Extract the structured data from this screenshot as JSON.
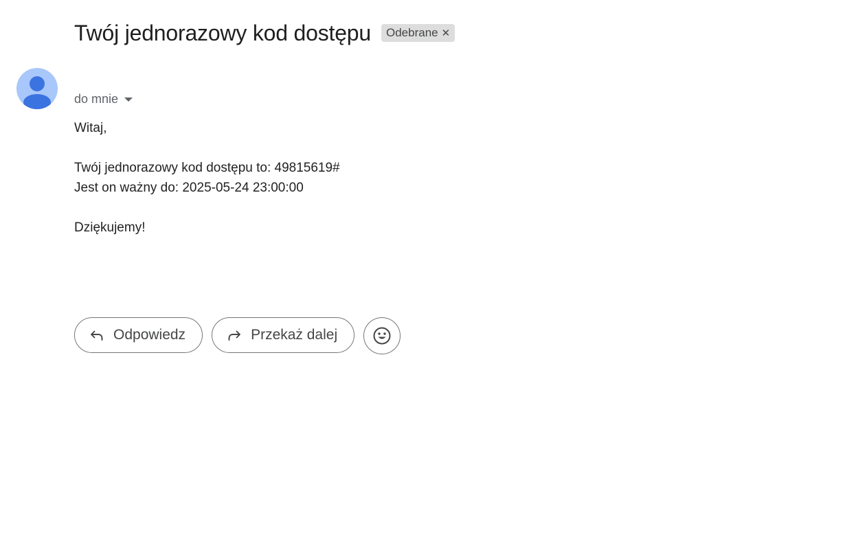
{
  "message": {
    "subject": "Twój jednorazowy kod dostępu",
    "label_chip": {
      "label": "Odebrane",
      "remove_icon": "close-icon"
    },
    "recipient": "do mnie",
    "avatar_icon": "person-avatar-icon",
    "body": {
      "greeting": "Witaj,",
      "code_line": "Twój jednorazowy kod dostępu to: 49815619#",
      "validity_line": "Jest on ważny do: 2025-05-24 23:00:00",
      "closing": "Dziękujemy!"
    }
  },
  "actions": {
    "reply_label": "Odpowiedz",
    "reply_icon": "reply-icon",
    "forward_label": "Przekaż dalej",
    "forward_icon": "forward-icon",
    "emoji_icon": "emoji-reaction-icon"
  },
  "colors": {
    "avatar_background": "#a8c7fa",
    "avatar_figure": "#3b73e0",
    "chip_background": "#dddddd",
    "button_border": "#747775"
  }
}
